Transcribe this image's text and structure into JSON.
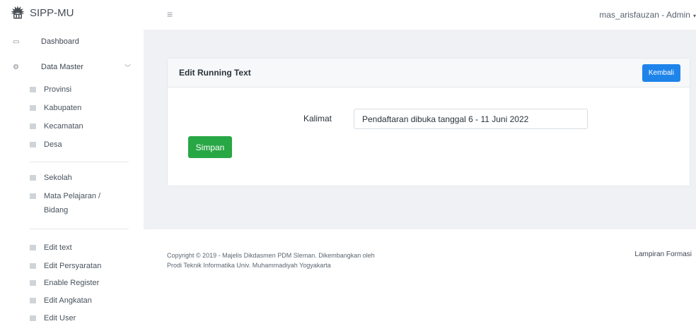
{
  "app": {
    "brand": "SIPP-MU",
    "logo_icon": "sun-emblem-icon"
  },
  "topbar": {
    "menu_icon": "≡",
    "user": "mas_arisfauzan - Admin",
    "caret": "▾"
  },
  "sidebar": {
    "dashboard": {
      "label": "Dashboard",
      "icon": "laptop-icon",
      "glyph": "▭"
    },
    "data_master": {
      "label": "Data Master",
      "icon": "gears-icon",
      "glyph": "⚙",
      "chevron": "﹀"
    },
    "items_group1": [
      "Provinsi",
      "Kabupaten",
      "Kecamatan",
      "Desa"
    ],
    "items_group2": [
      "Sekolah",
      "Mata Pelajaran /"
    ],
    "items_group2_continuation": "Bidang",
    "items_group3": [
      "Edit text",
      "Edit Persyaratan",
      "Enable Register",
      "Edit Angkatan",
      "Edit User"
    ]
  },
  "card": {
    "title": "Edit Running Text",
    "back_button": "Kembali",
    "field_label": "Kalimat",
    "field_value": "Pendaftaran dibuka tanggal 6 - 11 Juni 2022",
    "save_button": "Simpan"
  },
  "footer": {
    "copyright_line1": "Copyright © 2019 - Majelis Dikdasmen PDM Sleman. Dikembangkan oleh",
    "copyright_line2": "Prodi Teknik Informatika Univ. Muhammadiyah Yogyakarta",
    "link": "Lampiran Formasi"
  },
  "colors": {
    "primary": "#1f84ea",
    "success": "#28a745",
    "content_bg": "#f0f1f4"
  }
}
